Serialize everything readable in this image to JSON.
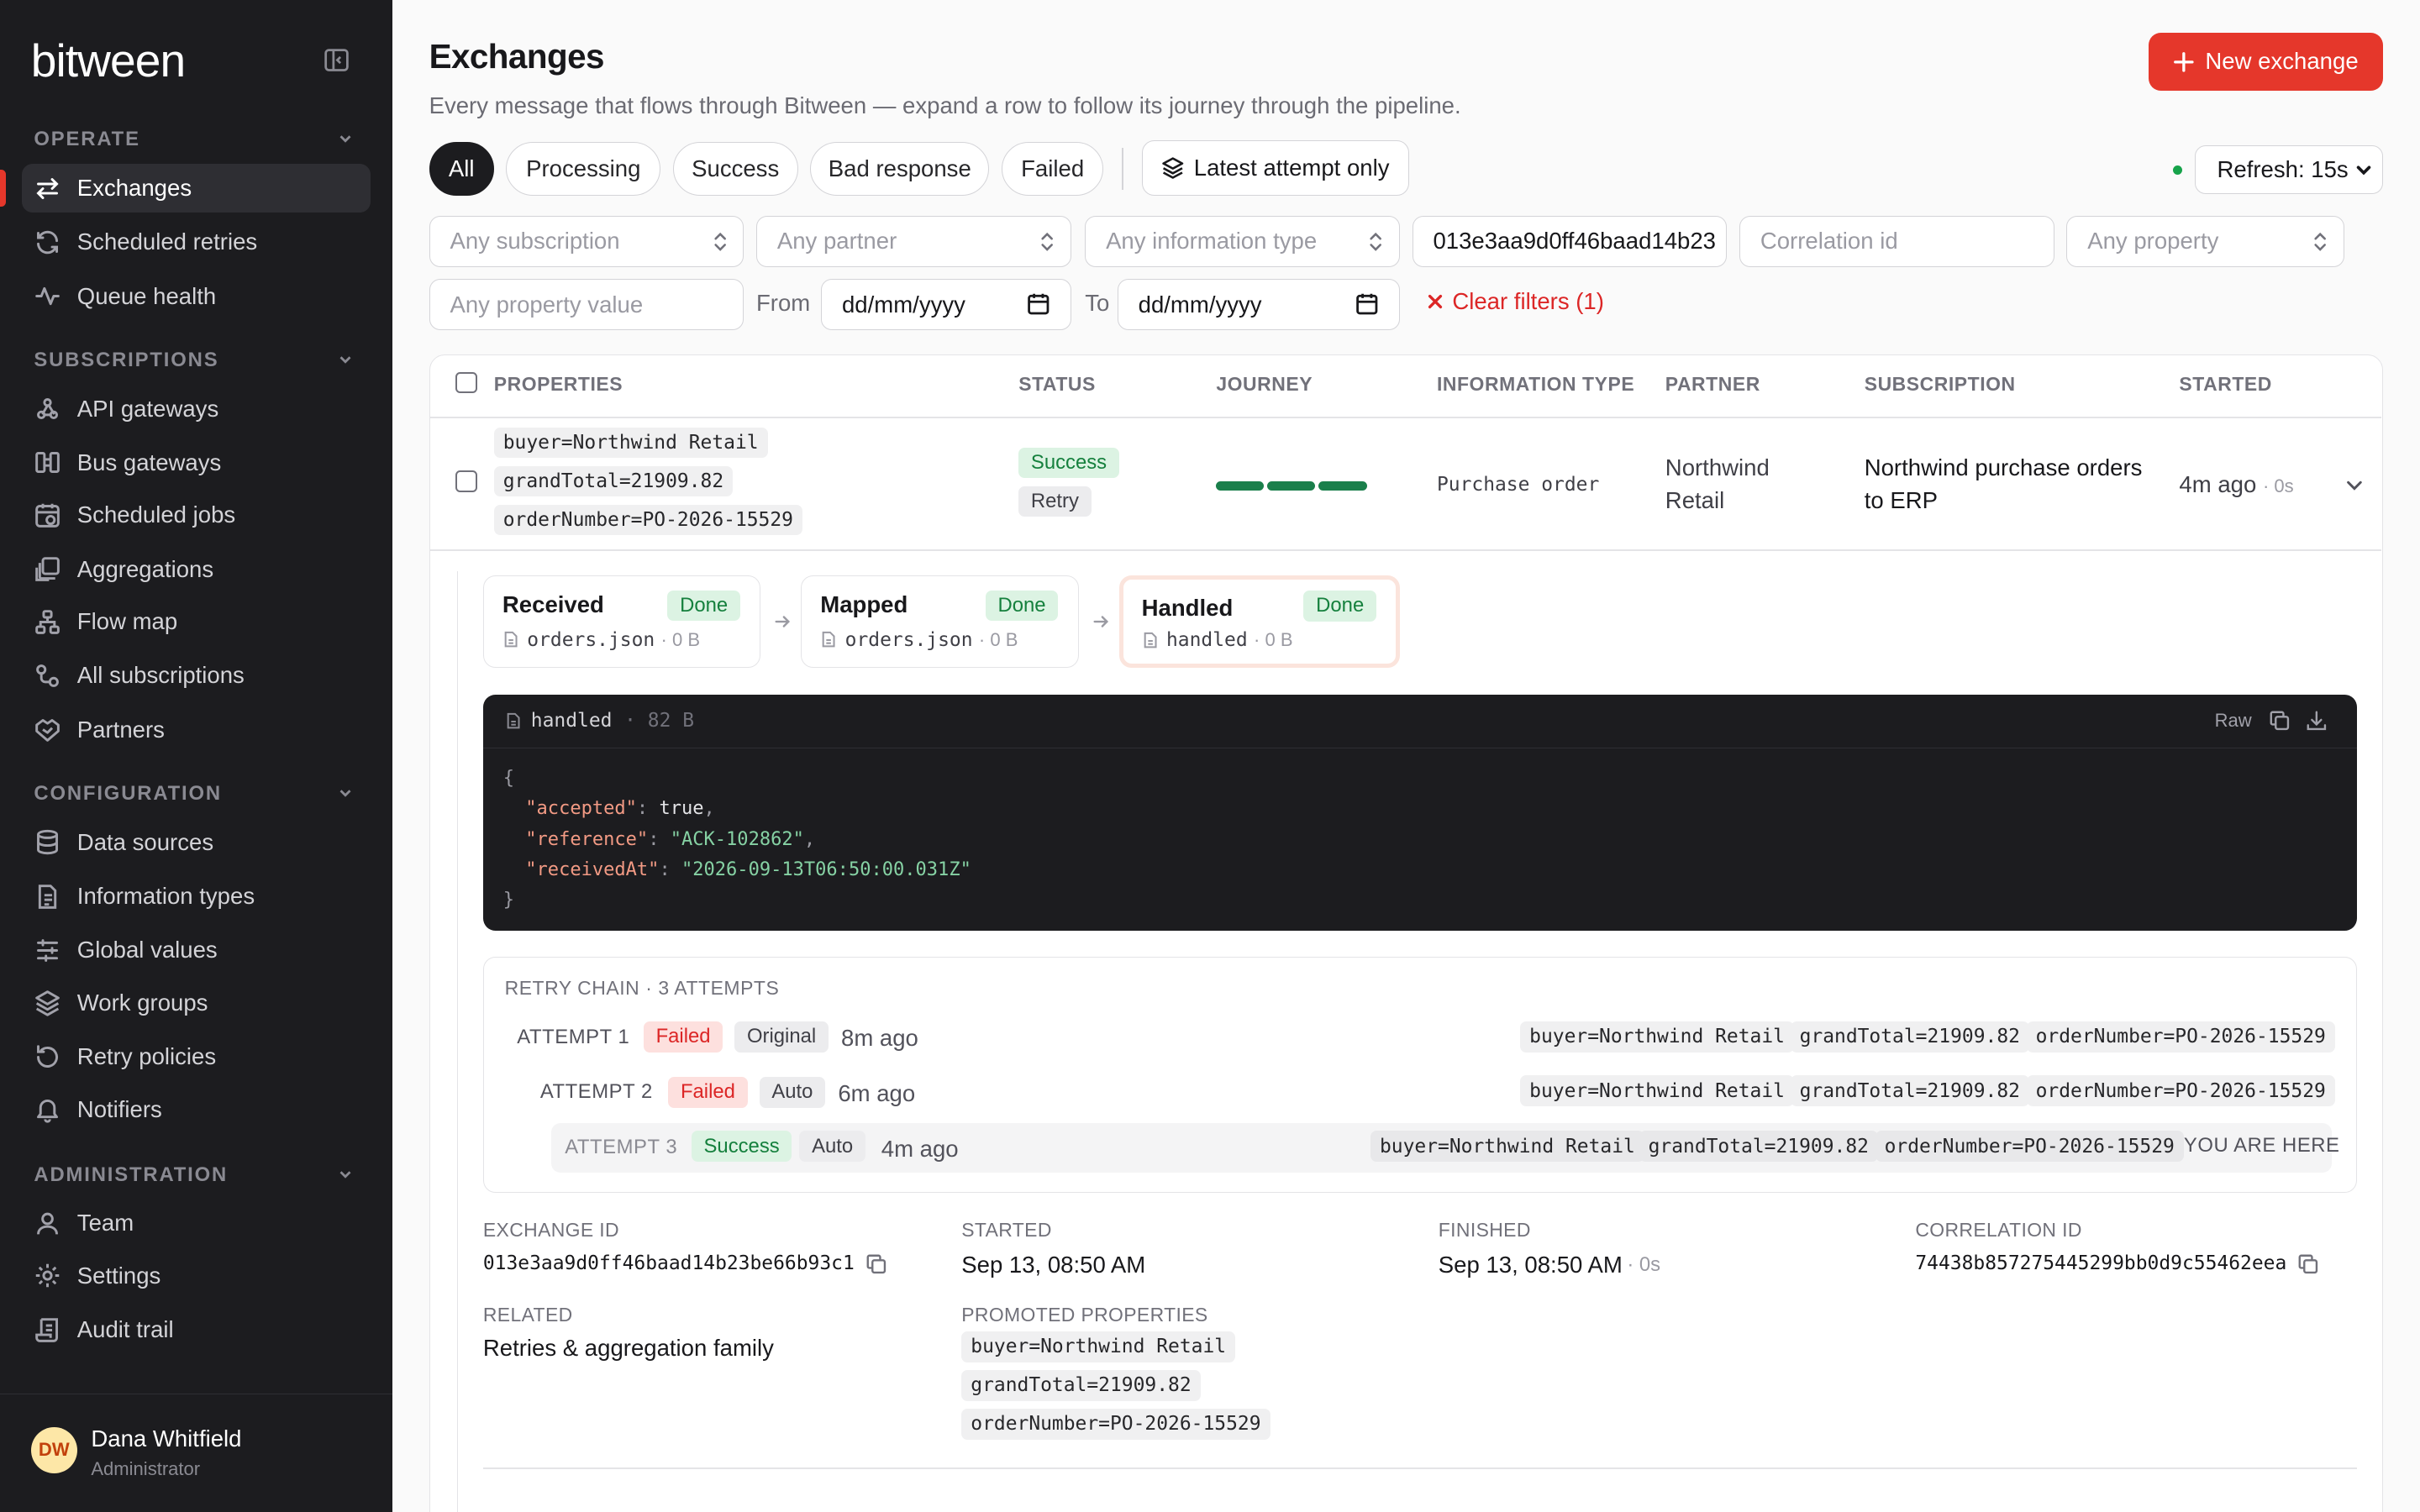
{
  "app": {
    "logo": "bitween"
  },
  "sidebar": {
    "sections": [
      {
        "title": "OPERATE",
        "items": [
          "Exchanges",
          "Scheduled retries",
          "Queue health"
        ]
      },
      {
        "title": "SUBSCRIPTIONS",
        "items": [
          "API gateways",
          "Bus gateways",
          "Scheduled jobs",
          "Aggregations",
          "Flow map",
          "All subscriptions",
          "Partners"
        ]
      },
      {
        "title": "CONFIGURATION",
        "items": [
          "Data sources",
          "Information types",
          "Global values",
          "Work groups",
          "Retry policies",
          "Notifiers"
        ]
      },
      {
        "title": "ADMINISTRATION",
        "items": [
          "Team",
          "Settings",
          "Audit trail"
        ]
      }
    ],
    "active": "Exchanges",
    "user": {
      "initials": "DW",
      "name": "Dana Whitfield",
      "role": "Administrator"
    }
  },
  "header": {
    "title": "Exchanges",
    "subtitle": "Every message that flows through Bitween — expand a row to follow its journey through the pipeline.",
    "new_button": "New exchange"
  },
  "filters": {
    "chips": [
      "All",
      "Processing",
      "Success",
      "Bad response",
      "Failed"
    ],
    "active_chip": "All",
    "latest_only": "Latest attempt only",
    "refresh": "Refresh: 15s",
    "subscription": "Any subscription",
    "partner": "Any partner",
    "information_type": "Any information type",
    "exchange_id": "013e3aa9d0ff46baad14b23",
    "correlation_placeholder": "Correlation id",
    "property": "Any property",
    "property_value_placeholder": "Any property value",
    "from_label": "From",
    "to_label": "To",
    "date_placeholder": "dd/mm/yyyy",
    "clear": "Clear filters (1)"
  },
  "table": {
    "columns": [
      "PROPERTIES",
      "STATUS",
      "JOURNEY",
      "INFORMATION TYPE",
      "PARTNER",
      "SUBSCRIPTION",
      "STARTED"
    ],
    "row": {
      "properties": [
        "buyer=Northwind Retail",
        "grandTotal=21909.82",
        "orderNumber=PO-2026-15529"
      ],
      "status": "Success",
      "status_sub": "Retry",
      "journey_steps": 3,
      "information_type": "Purchase order",
      "partner": "Northwind Retail",
      "subscription": "Northwind purchase orders to ERP",
      "started": "4m ago",
      "duration": "· 0s"
    }
  },
  "pipeline": [
    {
      "name": "Received",
      "status": "Done",
      "file": "orders.json",
      "size": "· 0 B"
    },
    {
      "name": "Mapped",
      "status": "Done",
      "file": "orders.json",
      "size": "· 0 B"
    },
    {
      "name": "Handled",
      "status": "Done",
      "file": "handled",
      "size": "· 0 B"
    }
  ],
  "payload": {
    "file": "handled",
    "size": "· 82 B",
    "raw": "Raw",
    "lines": [
      {
        "open": "{"
      },
      {
        "key": "\"accepted\"",
        "value": "true",
        "type": "t",
        "comma": ","
      },
      {
        "key": "\"reference\"",
        "value": "\"ACK-102862\"",
        "type": "s",
        "comma": ","
      },
      {
        "key": "\"receivedAt\"",
        "value": "\"2026-09-13T06:50:00.031Z\"",
        "type": "s",
        "comma": ""
      },
      {
        "open": "}"
      }
    ]
  },
  "retry_chain": {
    "title": "RETRY CHAIN · 3 ATTEMPTS",
    "attempts": [
      {
        "label": "ATTEMPT 1",
        "status": "Failed",
        "kind": "Original",
        "ago": "8m ago"
      },
      {
        "label": "ATTEMPT 2",
        "status": "Failed",
        "kind": "Auto",
        "ago": "6m ago"
      },
      {
        "label": "ATTEMPT 3",
        "status": "Success",
        "kind": "Auto",
        "ago": "4m ago"
      }
    ],
    "props": [
      "buyer=Northwind Retail",
      "grandTotal=21909.82",
      "orderNumber=PO-2026-15529"
    ],
    "you_are_here": "YOU ARE HERE"
  },
  "details": {
    "exchange_id_label": "EXCHANGE ID",
    "exchange_id": "013e3aa9d0ff46baad14b23be66b93c1",
    "started_label": "STARTED",
    "started": "Sep 13, 08:50 AM",
    "finished_label": "FINISHED",
    "finished": "Sep 13, 08:50 AM",
    "finished_dur": "· 0s",
    "correlation_label": "CORRELATION ID",
    "correlation_id": "74438b857275445299bb0d9c55462eea",
    "related_label": "RELATED",
    "related": "Retries & aggregation family",
    "promoted_label": "PROMOTED PROPERTIES"
  }
}
